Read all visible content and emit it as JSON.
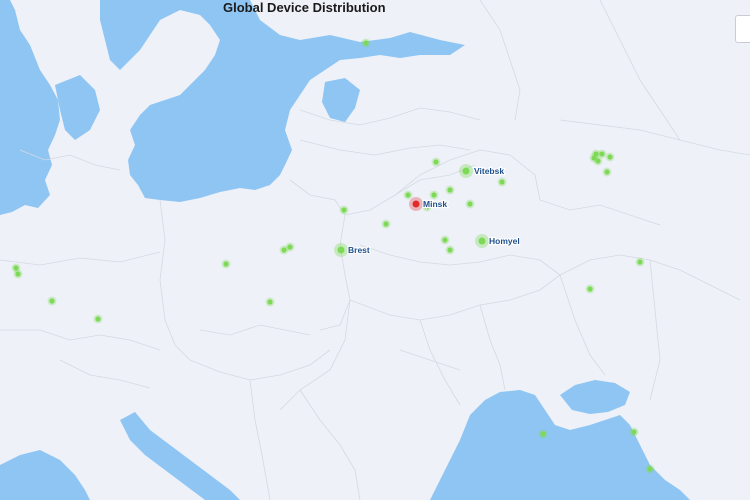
{
  "map": {
    "title": "Global Device Distribution",
    "colors": {
      "land": "#eef1f8",
      "water": "#8ec5f3",
      "border": "#d4d9e2",
      "device": "#7ed957",
      "highlight": "#e02b2b"
    },
    "cities": [
      {
        "name": "Vitebsk",
        "status": "online"
      },
      {
        "name": "Minsk",
        "status": "alert"
      },
      {
        "name": "Brest",
        "status": "online"
      },
      {
        "name": "Homyel",
        "status": "online"
      }
    ],
    "corner_control_icon": "panel-toggle-icon"
  }
}
